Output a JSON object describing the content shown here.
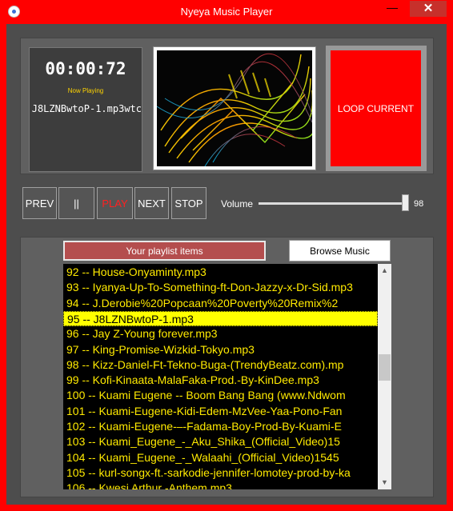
{
  "window": {
    "title": "Nyeya Music Player",
    "close_glyph": "✕",
    "minimize_glyph": "—",
    "accent": "#ff0000"
  },
  "player": {
    "time": "00:00:72",
    "now_playing_label": "Now Playing",
    "now_playing_track": "J8LZNBwtoP-1.mp3wtc",
    "loop_label": "LOOP CURRENT"
  },
  "controls": {
    "prev": "PREV",
    "pause": "||",
    "play": "PLAY",
    "next": "NEXT",
    "stop": "STOP"
  },
  "volume": {
    "label": "Volume",
    "value": "98",
    "level": 0.98
  },
  "playlist": {
    "header": "Your playlist items",
    "browse_label": "Browse Music",
    "selected_index": 3,
    "items": [
      "92 -- House-Onyaminty.mp3",
      "93 -- Iyanya-Up-To-Something-ft-Don-Jazzy-x-Dr-Sid.mp3",
      "94 -- J.Derobie%20Popcaan%20Poverty%20Remix%2",
      "95 -- J8LZNBwtoP-1.mp3",
      "96 -- Jay Z-Young forever.mp3",
      "97 -- King-Promise-Wizkid-Tokyo.mp3",
      "98 -- Kizz-Daniel-Ft-Tekno-Buga-(TrendyBeatz.com).mp",
      "99 -- Kofi-Kinaata-MalaFaka-Prod.-By-KinDee.mp3",
      "100 -- Kuami Eugene -- Boom Bang Bang (www.Ndwom",
      "101 -- Kuami-Eugene-Kidi-Edem-MzVee-Yaa-Pono-Fan",
      "102 -- Kuami-Eugene-–-Fadama-Boy-Prod-By-Kuami-E",
      "103 -- Kuami_Eugene_-_Aku_Shika_(Official_Video)15",
      "104 -- Kuami_Eugene_-_Walaahi_(Official_Video)1545",
      "105 -- kurl-songx-ft.-sarkodie-jennifer-lomotey-prod-by-ka",
      "106 -- Kwesi Arthur -Anthem.mp3"
    ]
  },
  "icons": {
    "scroll_up": "▲",
    "scroll_down": "▼"
  }
}
